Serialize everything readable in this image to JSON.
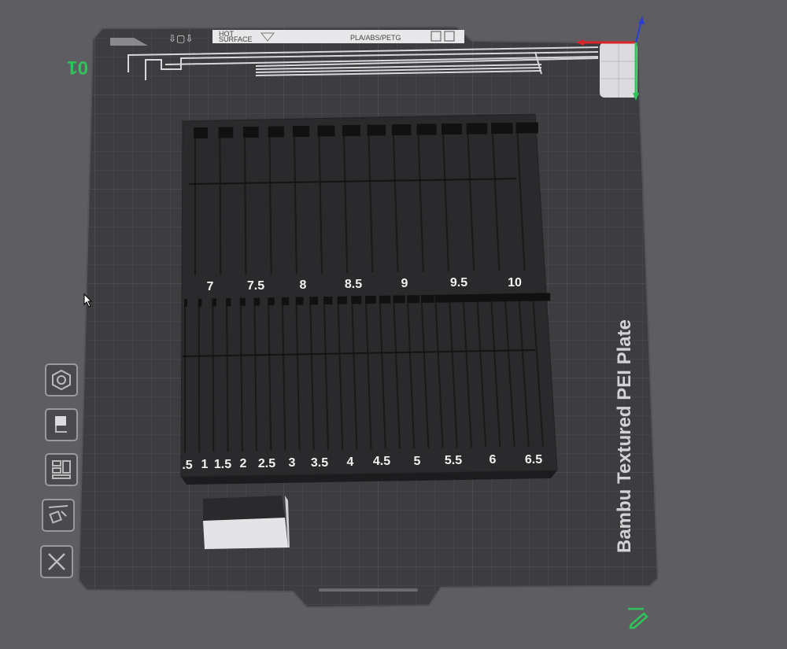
{
  "plate": {
    "number": "01",
    "type_label": "Bambu Textured PEI Plate",
    "tag_filaments": "PLA/ABS/PETG",
    "tag_surface_line1": "HOT",
    "tag_surface_line2": "SURFACE"
  },
  "model": {
    "row_top_labels": [
      "7",
      "7.5",
      "8",
      "8.5",
      "9",
      "9.5",
      "10"
    ],
    "row_bottom_labels": [
      ".5",
      "1",
      "1.5",
      "2",
      "2.5",
      "3",
      "3.5",
      "4",
      "4.5",
      "5",
      "5.5",
      "6",
      "6.5"
    ]
  },
  "toolbar": {
    "items": [
      {
        "icon": "hexagon-icon",
        "name": "tool-hexagon"
      },
      {
        "icon": "paint-bucket-icon",
        "name": "tool-support-paint"
      },
      {
        "icon": "layout-icon",
        "name": "tool-arrange"
      },
      {
        "icon": "auto-orient-icon",
        "name": "tool-auto-orient"
      },
      {
        "icon": "close-icon",
        "name": "tool-close"
      }
    ]
  },
  "colors": {
    "background": "#5e5e62",
    "plate": "#3d3d40",
    "model": "#2a2a2c",
    "accent_green": "#2fc35a",
    "axis_red": "#d8262a",
    "axis_blue": "#2a3fd0"
  }
}
